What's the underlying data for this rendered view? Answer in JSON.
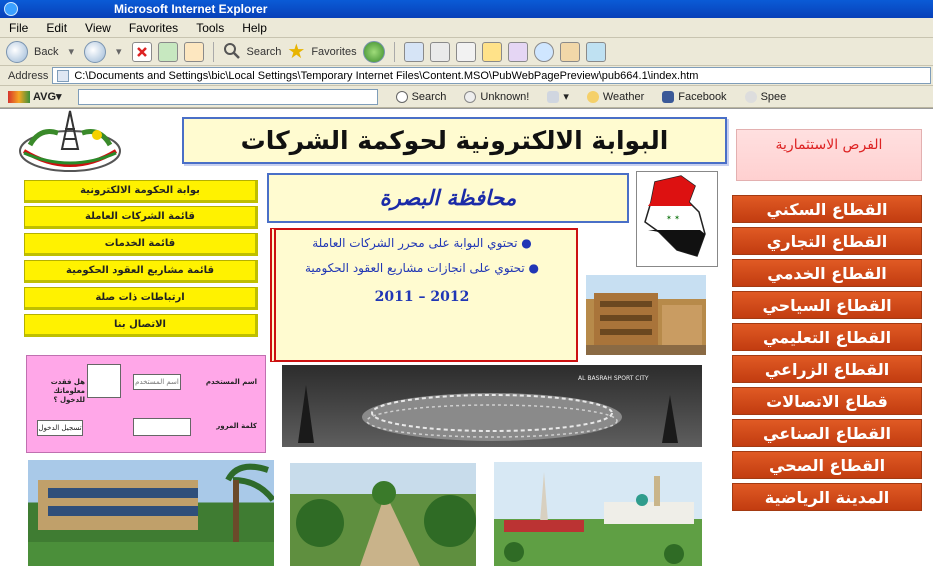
{
  "browser": {
    "title": "Microsoft Internet Explorer",
    "menu": [
      "File",
      "Edit",
      "View",
      "Favorites",
      "Tools",
      "Help"
    ],
    "toolbar": {
      "back_label": "Back",
      "search_label": "Search",
      "favorites_label": "Favorites"
    },
    "address_label": "Address",
    "address_value": "C:\\Documents and Settings\\bic\\Local Settings\\Temporary Internet Files\\Content.MSO\\PubWebPagePreview\\pub664.1\\index.htm",
    "avg": {
      "logo": "AVG",
      "search_label": "Search",
      "unknown_label": "Unknown!",
      "weather_label": "Weather",
      "facebook_label": "Facebook",
      "speed_label": "Spee"
    }
  },
  "page": {
    "banner_title": "البوابة الالكترونية لحوكمة الشركات",
    "opportunities": "الفرص الاستثمارية",
    "province": "محافظة البصرة",
    "left_menu": [
      "بوابة الحكومة الالكترونية",
      "قائمة الشركات العاملة",
      "قائمة الخدمات",
      "قائمة مشاريع العقود الحكومية",
      "ارتباطات ذات صلة",
      "الاتصال بنا"
    ],
    "info": {
      "line1": "تحتوي البوابة على محرر الشركات العاملة",
      "line2": "تحتوي على انجازات مشاريع العقود الحكومية",
      "years": "2012 – 2011"
    },
    "sectors": [
      "القطاع السكني",
      "القطاع التجاري",
      "القطاع الخدمي",
      "القطاع السياحي",
      "القطاع التعليمي",
      "القطاع الزراعي",
      "قطاع الاتصالات",
      "القطاع الصناعي",
      "القطاع الصحي",
      "المدينة الرياضية"
    ],
    "login": {
      "username_label": "اسم المستخدم",
      "username_placeholder": "اسم المستخدم",
      "forgot_label": "هل فقدت معلوماتك للدخول ؟",
      "password_label": "كلمة المرور",
      "login_button": "تسجيل الدخول"
    },
    "stadium_caption": "AL BASRAH SPORT CITY"
  }
}
